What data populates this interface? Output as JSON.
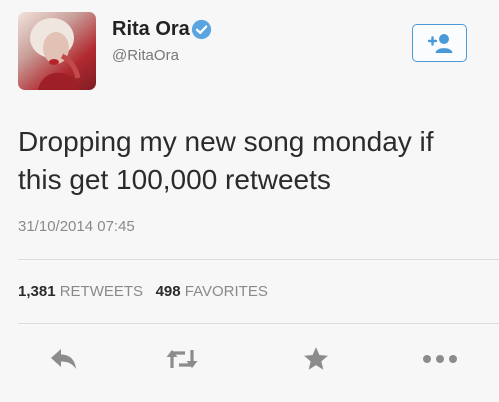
{
  "user": {
    "display_name": "Rita Ora",
    "handle": "@RitaOra",
    "verified": true
  },
  "follow_button": {
    "icon": "follow-user-icon"
  },
  "tweet": {
    "text": "Dropping my new song monday if this get 100,000 retweets",
    "timestamp": "31/10/2014 07:45"
  },
  "stats": {
    "retweets_count": "1,381",
    "retweets_label": "RETWEETS",
    "favorites_count": "498",
    "favorites_label": "FAVORITES"
  },
  "actions": [
    {
      "name": "reply",
      "icon": "reply-icon"
    },
    {
      "name": "retweet",
      "icon": "retweet-icon"
    },
    {
      "name": "favorite",
      "icon": "star-icon"
    },
    {
      "name": "more",
      "icon": "more-icon"
    }
  ],
  "colors": {
    "accent": "#4a9ad8",
    "icon_gray": "#8c8c8c",
    "muted_text": "#8a8a8a"
  }
}
